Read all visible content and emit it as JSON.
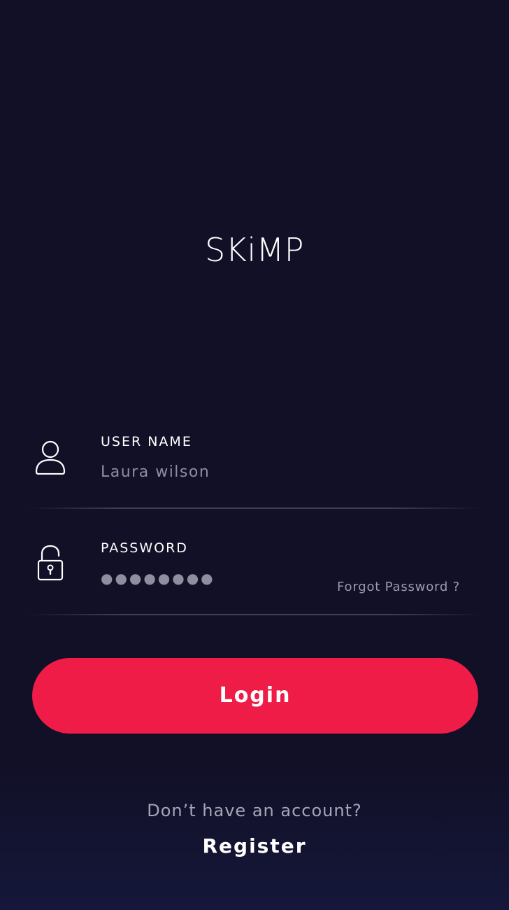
{
  "app": {
    "logo_text": "SKiMP"
  },
  "username_field": {
    "label": "USER NAME",
    "value": "Laura wilson",
    "icon": "user-icon"
  },
  "password_field": {
    "label": "PASSWORD",
    "value_masked": "●●●●●●●●",
    "icon": "lock-icon",
    "forgot_label": "Forgot Password ?"
  },
  "actions": {
    "login_label": "Login",
    "register_prompt": "Don’t have an account?",
    "register_label": "Register"
  },
  "colors": {
    "background": "#111027",
    "accent": "#ee1c47",
    "muted_text": "#8f8ea0"
  }
}
